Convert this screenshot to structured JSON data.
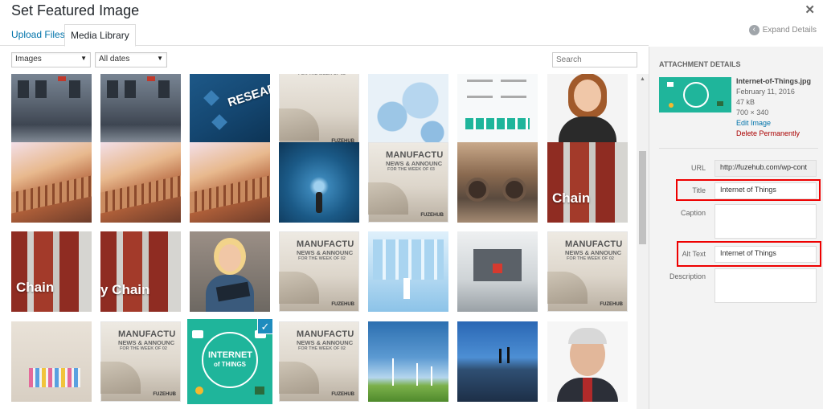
{
  "title": "Set Featured Image",
  "tabs": [
    {
      "label": "Upload Files"
    },
    {
      "label": "Media Library"
    }
  ],
  "expand_label": "Expand Details",
  "filters": {
    "type": "Images",
    "date": "All dates",
    "search_placeholder": "Search"
  },
  "grid": {
    "rows": [
      [
        "Subway train",
        "Subway train",
        "RESEARCH",
        "Manufacturing news",
        "Gears",
        "Infographic",
        "Woman portrait"
      ],
      [
        "Train",
        "Train",
        "Train",
        "Business man light",
        "Manufacturing news",
        "Railcar",
        "Chain"
      ],
      [
        "Chain",
        "y Chain",
        "Woman with tablet",
        "Manufacturing news",
        "Maze",
        "Machine",
        "Manufacturing news"
      ],
      [
        "Crayons",
        "Manufacturing news",
        "Internet of Things",
        "Manufacturing news",
        "Wind turbines",
        "Solar panels",
        "Man portrait"
      ]
    ],
    "labels": {
      "chain": "Chain",
      "ychain": "y Chain",
      "research": "RESEARCH",
      "iot1": "INTERNET",
      "iot2": "of THINGS"
    },
    "paper": {
      "h1": "MANUFACTU",
      "h2": "NEWS & ANNOUNC",
      "h3a": "FOR THE WEEK OF 03",
      "h3b": "FOR THE WEEK OF 02",
      "brand": "FUZEHUB"
    },
    "selected": "Internet of Things"
  },
  "details": {
    "heading": "ATTACHMENT DETAILS",
    "filename": "Internet-of-Things.jpg",
    "date": "February 11, 2016",
    "size": "47 kB",
    "dims": "700 × 340",
    "edit": "Edit Image",
    "delete": "Delete Permanently"
  },
  "fields": {
    "url_label": "URL",
    "url_value": "http://fuzehub.com/wp-cont",
    "title_label": "Title",
    "title_value": "Internet of Things",
    "caption_label": "Caption",
    "caption_value": "",
    "alt_label": "Alt Text",
    "alt_value": "Internet of Things",
    "desc_label": "Description",
    "desc_value": ""
  },
  "colors": {
    "accent": "#1e8cbe",
    "link": "#0073aa",
    "highlight": "#ee0000",
    "delete": "#aa0000"
  }
}
